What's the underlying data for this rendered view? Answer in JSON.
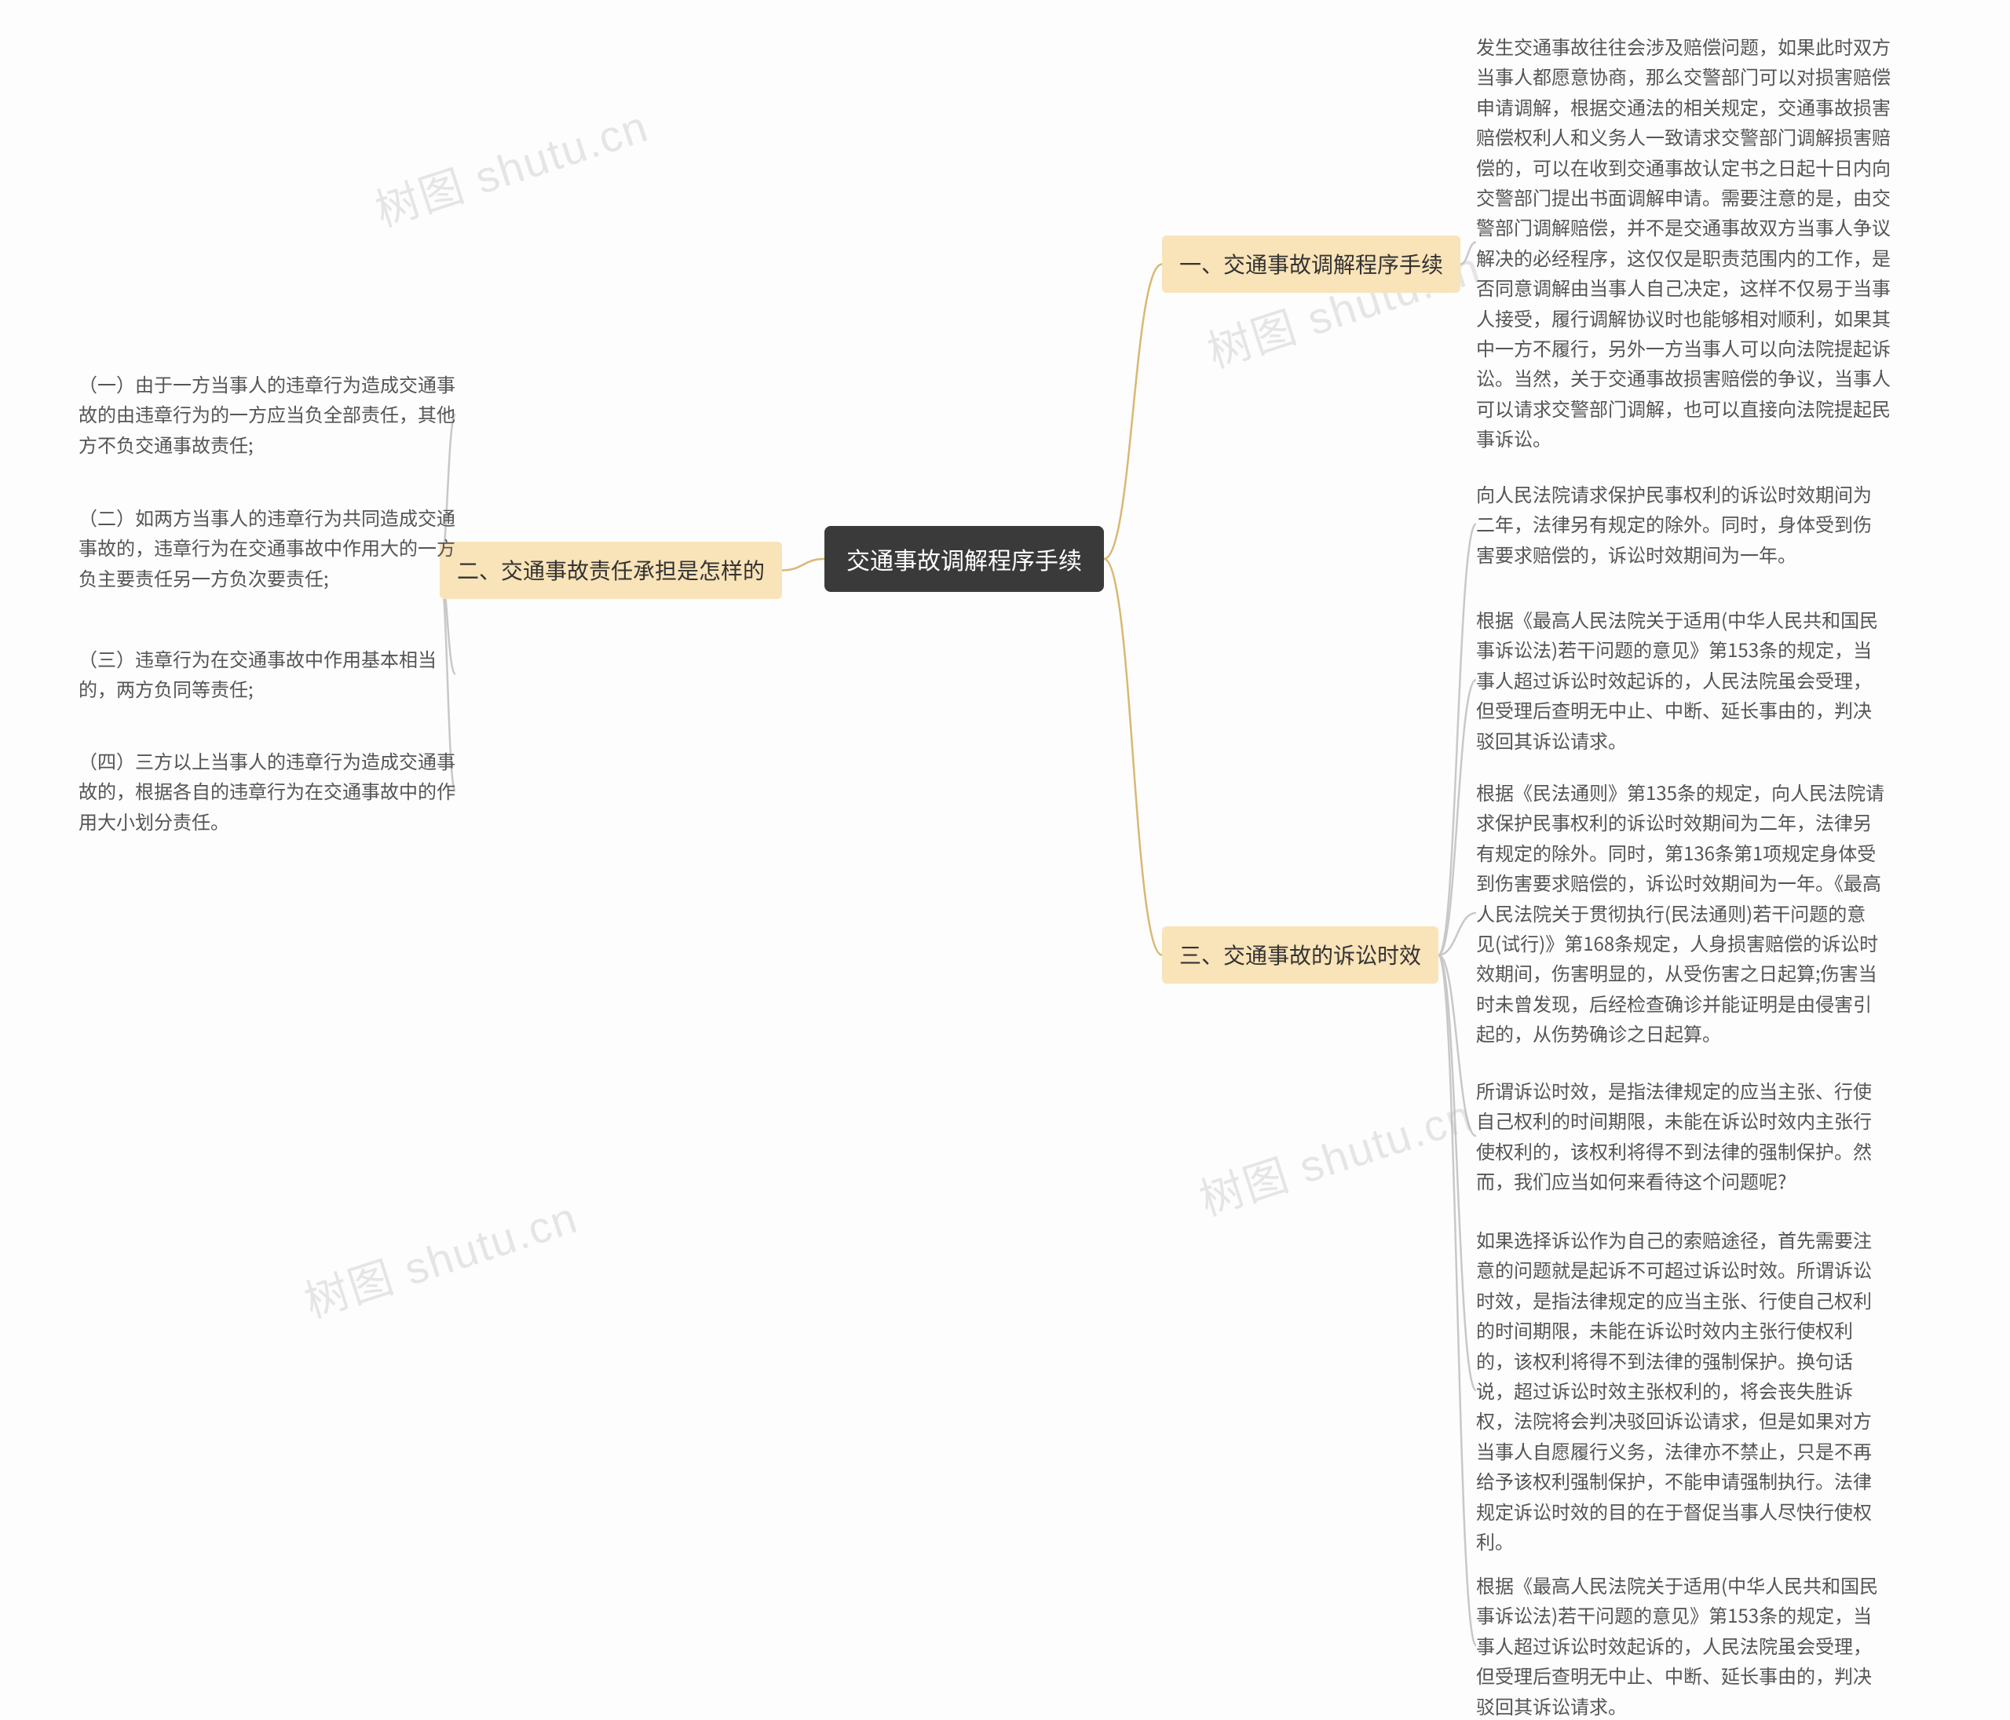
{
  "center": {
    "title": "交通事故调解程序手续"
  },
  "watermark": "树图 shutu.cn",
  "branches": {
    "b1": {
      "title": "一、交通事故调解程序手续",
      "leaf": "发生交通事故往往会涉及赔偿问题，如果此时双方当事人都愿意协商，那么交警部门可以对损害赔偿申请调解，根据交通法的相关规定，交通事故损害赔偿权利人和义务人一致请求交警部门调解损害赔偿的，可以在收到交通事故认定书之日起十日内向交警部门提出书面调解申请。需要注意的是，由交警部门调解赔偿，并不是交通事故双方当事人争议解决的必经程序，这仅仅是职责范围内的工作，是否同意调解由当事人自己决定，这样不仅易于当事人接受，履行调解协议时也能够相对顺利，如果其中一方不履行，另外一方当事人可以向法院提起诉讼。当然，关于交通事故损害赔偿的争议，当事人可以请求交警部门调解，也可以直接向法院提起民事诉讼。"
    },
    "b2": {
      "title": "二、交通事故责任承担是怎样的",
      "leaves": [
        "（一）由于一方当事人的违章行为造成交通事故的由违章行为的一方应当负全部责任，其他方不负交通事故责任;",
        "（二）如两方当事人的违章行为共同造成交通事故的，违章行为在交通事故中作用大的一方负主要责任另一方负次要责任;",
        "（三）违章行为在交通事故中作用基本相当的，两方负同等责任;",
        "（四）三方以上当事人的违章行为造成交通事故的，根据各自的违章行为在交通事故中的作用大小划分责任。"
      ]
    },
    "b3": {
      "title": "三、交通事故的诉讼时效",
      "leaves": [
        "向人民法院请求保护民事权利的诉讼时效期间为二年，法律另有规定的除外。同时，身体受到伤害要求赔偿的，诉讼时效期间为一年。",
        "根据《最高人民法院关于适用(中华人民共和国民事诉讼法)若干问题的意见》第153条的规定，当事人超过诉讼时效起诉的，人民法院虽会受理，但受理后查明无中止、中断、延长事由的，判决驳回其诉讼请求。",
        "根据《民法通则》第135条的规定，向人民法院请求保护民事权利的诉讼时效期间为二年，法律另有规定的除外。同时，第136条第1项规定身体受到伤害要求赔偿的，诉讼时效期间为一年。《最高人民法院关于贯彻执行(民法通则)若干问题的意见(试行)》第168条规定，人身损害赔偿的诉讼时效期间，伤害明显的，从受伤害之日起算;伤害当时未曾发现，后经检查确诊并能证明是由侵害引起的，从伤势确诊之日起算。",
        "所谓诉讼时效，是指法律规定的应当主张、行使自己权利的时间期限，未能在诉讼时效内主张行使权利的，该权利将得不到法律的强制保护。然而，我们应当如何来看待这个问题呢?",
        "如果选择诉讼作为自己的索赔途径，首先需要注意的问题就是起诉不可超过诉讼时效。所谓诉讼时效，是指法律规定的应当主张、行使自己权利的时间期限，未能在诉讼时效内主张行使权利的，该权利将得不到法律的强制保护。换句话说，超过诉讼时效主张权利的，将会丧失胜诉权，法院将会判决驳回诉讼请求，但是如果对方当事人自愿履行义务，法律亦不禁止，只是不再给予该权利强制保护，不能申请强制执行。法律规定诉讼时效的目的在于督促当事人尽快行使权利。",
        "根据《最高人民法院关于适用(中华人民共和国民事诉讼法)若干问题的意见》第153条的规定，当事人超过诉讼时效起诉的，人民法院虽会受理，但受理后查明无中止、中断、延长事由的，判决驳回其诉讼请求。"
      ]
    }
  }
}
